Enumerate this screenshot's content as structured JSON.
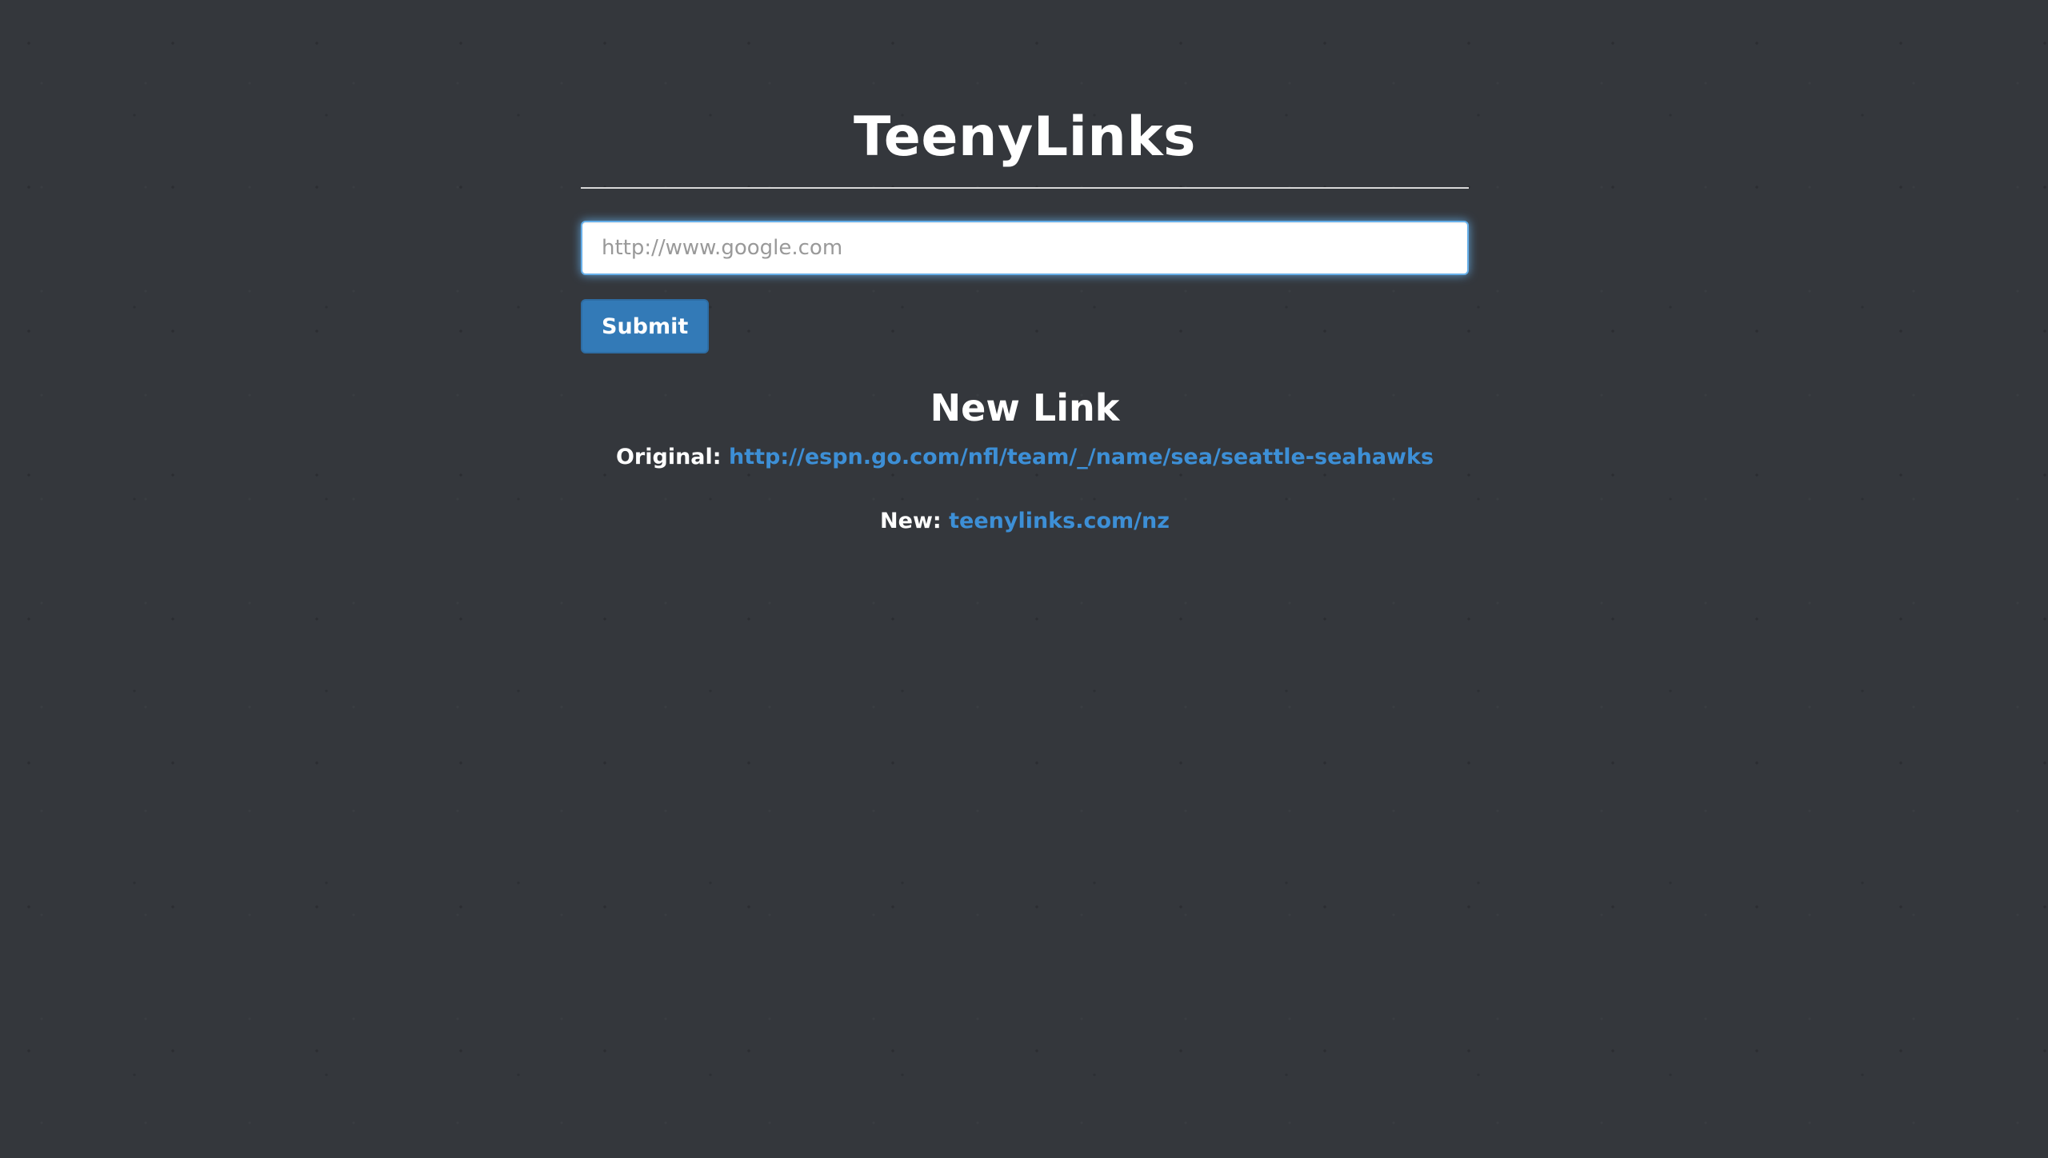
{
  "app": {
    "title": "TeenyLinks"
  },
  "form": {
    "url_input_placeholder": "http://www.google.com",
    "url_input_value": "",
    "submit_label": "Submit"
  },
  "result": {
    "heading": "New Link",
    "original_label": "Original:",
    "original_url": "http://espn.go.com/nfl/team/_/name/sea/seattle-seahawks",
    "new_label": "New:",
    "new_url": "teenylinks.com/nz"
  },
  "colors": {
    "background": "#34373c",
    "accent": "#337ab7",
    "link": "#3d8fd6",
    "focus_glow": "#66afe9"
  }
}
